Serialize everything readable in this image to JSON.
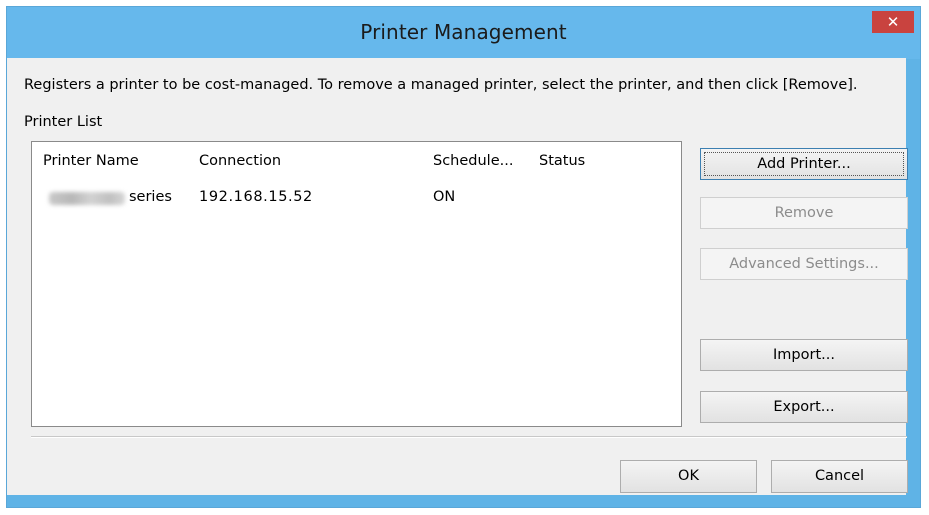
{
  "window": {
    "title": "Printer Management",
    "close_label": "✕"
  },
  "description": "Registers a printer to be cost-managed. To remove a managed printer, select the printer, and then click [Remove].",
  "printer_list": {
    "label": "Printer List",
    "columns": [
      "Printer Name",
      "Connection",
      "Schedule...",
      "Status"
    ],
    "rows": [
      {
        "name_suffix": "series",
        "connection": "192.168.15.52",
        "schedule": "ON",
        "status": ""
      }
    ]
  },
  "buttons": {
    "add_printer": "Add Printer...",
    "remove": "Remove",
    "advanced_settings": "Advanced Settings...",
    "import": "Import...",
    "export": "Export...",
    "ok": "OK",
    "cancel": "Cancel"
  }
}
